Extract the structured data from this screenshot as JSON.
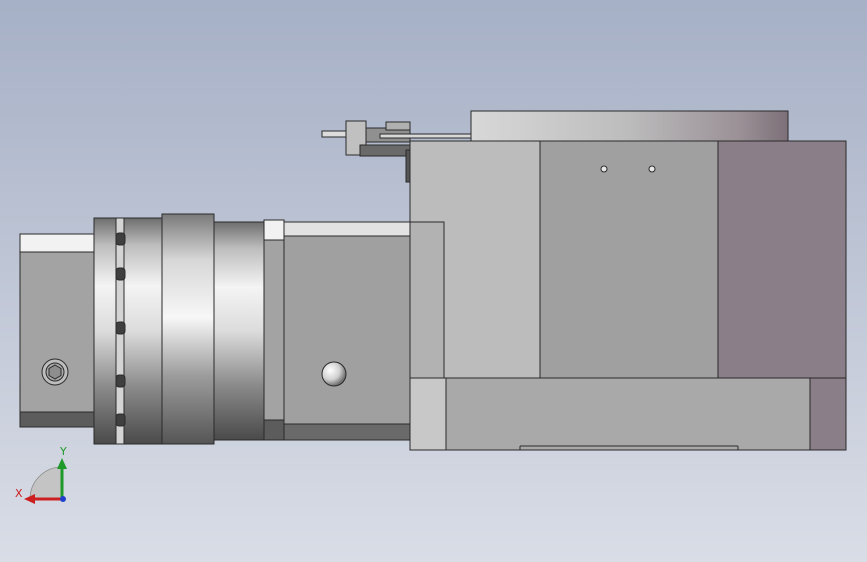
{
  "viewport": {
    "background_top": "#a6b0c6",
    "background_bottom": "#d9dde6"
  },
  "triad": {
    "x_label": "X",
    "y_label": "Y",
    "x_color": "#cc1f1f",
    "y_color": "#1f9a2a",
    "z_color": "#1f3fcc"
  },
  "colors": {
    "outline": "#2a2a2a",
    "gray_mid": "#a3a3a3",
    "gray_light": "#c8c8c8",
    "gray_dark": "#5c5c5c",
    "mauve": "#8a7e88",
    "white": "#f2f2f2"
  }
}
